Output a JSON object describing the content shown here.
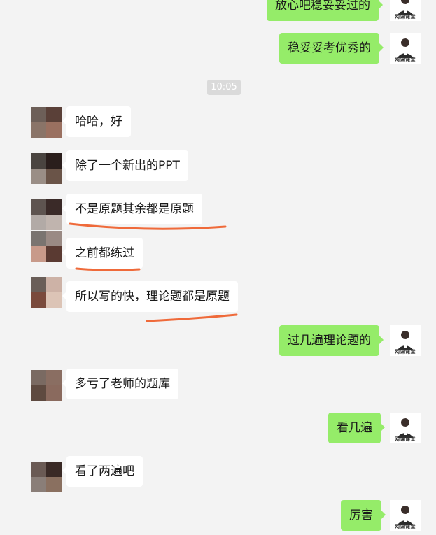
{
  "timestamp": "10:05",
  "messages": [
    {
      "side": "out",
      "text": "放心吧稳妥妥过的"
    },
    {
      "side": "out",
      "text": "稳妥妥考优秀的"
    },
    {
      "side": "in",
      "text": "哈哈，好"
    },
    {
      "side": "in",
      "text": "除了一个新出的PPT"
    },
    {
      "side": "in",
      "text": "不是原题其余都是原题"
    },
    {
      "side": "in",
      "text": "之前都练过"
    },
    {
      "side": "in",
      "text": "所以写的快，理论题都是原题"
    },
    {
      "side": "out",
      "text": "过几遍理论题的"
    },
    {
      "side": "in",
      "text": "多亏了老师的题库"
    },
    {
      "side": "out",
      "text": "看几遍"
    },
    {
      "side": "in",
      "text": "看了两遍吧"
    },
    {
      "side": "out",
      "text": "厉害"
    }
  ],
  "my_avatar_label": "网课课堂",
  "colors": {
    "background": "#f3f3f3",
    "outgoing_bubble": "#95ec69",
    "incoming_bubble": "#ffffff",
    "annotation": "#ef6a3a"
  }
}
